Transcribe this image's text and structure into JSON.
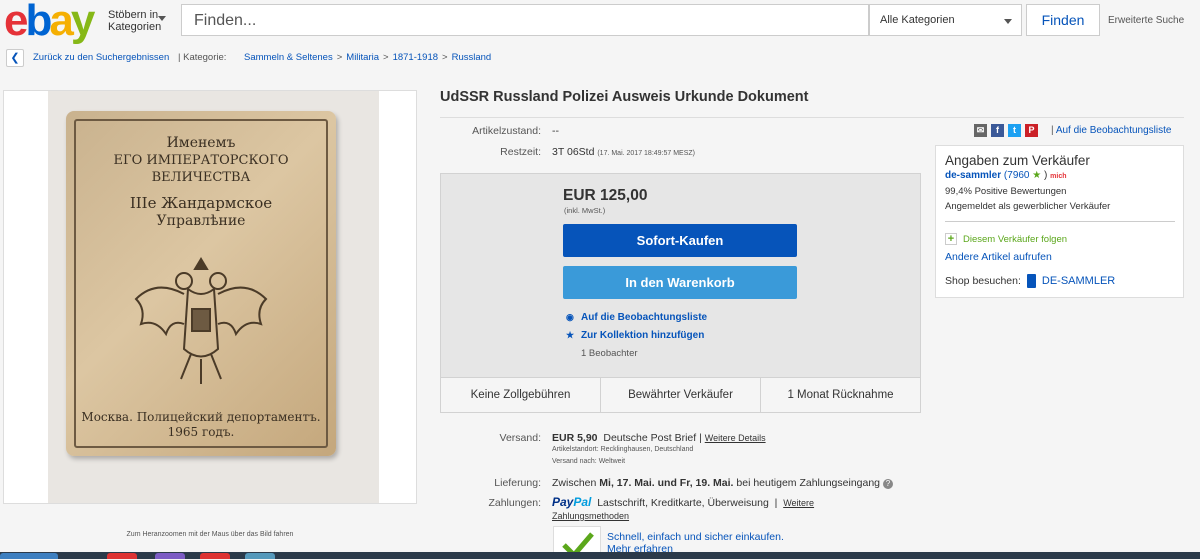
{
  "header": {
    "logo": [
      "e",
      "b",
      "a",
      "y"
    ],
    "browse_label": "Stöbern in Kategorien",
    "browse_line1": "Stöbern in",
    "browse_line2": "Kategorien",
    "search_placeholder": "Finden...",
    "category_select": "Alle Kategorien",
    "find_button": "Finden",
    "advanced_search": "Erweiterte Suche"
  },
  "breadcrumb": {
    "back": "Zurück zu den Suchergebnissen",
    "category_label": "Kategorie:",
    "items": [
      "Sammeln & Seltenes",
      "Militaria",
      "1871-1918",
      "Russland"
    ],
    "separator": ">"
  },
  "image": {
    "zoom_hint": "Zum Heranzoomen mit der Maus über das Bild fahren",
    "card_lines": [
      "Именемъ",
      "ЕГО ИМПЕРАТОРСКОГО",
      "ВЕЛИЧЕСТВА",
      "IIIе Жандармское",
      "Управлѣние"
    ],
    "card_footer": [
      "Москва. Полицейский депортаментъ.",
      "1965 годъ."
    ]
  },
  "listing": {
    "title": "UdSSR Russland Polizei Ausweis Urkunde Dokument",
    "condition_label": "Artikelzustand:",
    "condition_value": "--",
    "time_label": "Restzeit:",
    "time_value": "3T 06Std",
    "time_detail": "(17. Mai. 2017   18:49:57 MESZ)",
    "watchlist_link": "Auf die Beobachtungsliste",
    "social_icons": [
      "mail-icon",
      "facebook-icon",
      "twitter-icon",
      "pinterest-icon"
    ]
  },
  "buy": {
    "price": "EUR 125,00",
    "tax_note": "(inkl. MwSt.)",
    "buy_now": "Sofort-Kaufen",
    "add_cart": "In den Warenkorb",
    "watch": "Auf die Beobachtungsliste",
    "collection": "Zur Kollektion hinzufügen",
    "watchers": "1 Beobachter"
  },
  "badges": [
    "Keine Zollgebühren",
    "Bewährter Verkäufer",
    "1 Monat Rücknahme"
  ],
  "shipping": {
    "label": "Versand:",
    "price": "EUR 5,90",
    "method": "Deutsche Post Brief",
    "details_link": "Weitere Details",
    "location": "Artikelstandort:  Recklinghausen, Deutschland",
    "ships_to": "Versand nach:  Weltweit"
  },
  "delivery": {
    "label": "Lieferung:",
    "prefix": "Zwischen",
    "range": "Mi, 17. Mai. und Fr, 19. Mai.",
    "suffix": "bei heutigem Zahlungseingang"
  },
  "payment": {
    "label": "Zahlungen:",
    "paypal_a": "Pay",
    "paypal_b": "Pal",
    "methods": "Lastschrift,  Kreditkarte,  Überweisung",
    "more_link_a": "Weitere",
    "more_link_b": "Zahlungsmethoden"
  },
  "guarantee": {
    "line1": "Schnell, einfach und sicher einkaufen.",
    "line2": "Mehr erfahren"
  },
  "seller": {
    "heading": "Angaben zum Verkäufer",
    "name": "de-sammler",
    "rating": "(7960",
    "rating_close": ")",
    "badge": "mich",
    "positive": "99,4% Positive Bewertungen",
    "commercial": "Angemeldet als gewerblicher Verkäufer",
    "follow": "Diesem Verkäufer folgen",
    "other_items": "Andere Artikel aufrufen",
    "shop_label": "Shop besuchen:",
    "shop_name": "DE-SAMMLER"
  },
  "colors": {
    "primary": "#0654ba",
    "secondary": "#3a9ad9",
    "star": "#5ba71b"
  }
}
